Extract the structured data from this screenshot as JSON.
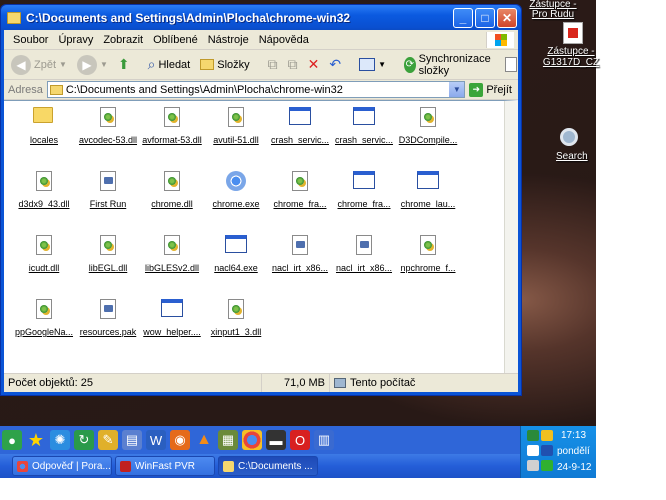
{
  "window": {
    "title": "C:\\Documents and Settings\\Admin\\Plocha\\chrome-win32"
  },
  "menu": [
    "Soubor",
    "Úpravy",
    "Zobrazit",
    "Oblíbené",
    "Nástroje",
    "Nápověda"
  ],
  "toolbar": {
    "back": "Zpět",
    "search": "Hledat",
    "folders": "Složky",
    "sync": "Synchronizace složky"
  },
  "address": {
    "label": "Adresa",
    "value": "C:\\Documents and Settings\\Admin\\Plocha\\chrome-win32",
    "go": "Přejít"
  },
  "files": [
    {
      "name": "locales",
      "icon": "folder-icon"
    },
    {
      "name": "avcodec-53.dll",
      "icon": "dll-icon"
    },
    {
      "name": "avformat-53.dll",
      "icon": "dll-icon"
    },
    {
      "name": "avutil-51.dll",
      "icon": "dll-icon"
    },
    {
      "name": "crash_servic...",
      "icon": "exe-icon"
    },
    {
      "name": "crash_servic...",
      "icon": "exe-icon"
    },
    {
      "name": "D3DCompile...",
      "icon": "dll-icon"
    },
    {
      "name": "d3dx9_43.dll",
      "icon": "dll-icon"
    },
    {
      "name": "First Run",
      "icon": "file-icon"
    },
    {
      "name": "chrome.dll",
      "icon": "dll-icon"
    },
    {
      "name": "chrome.exe",
      "icon": "chrome-icon"
    },
    {
      "name": "chrome_fra...",
      "icon": "dll-icon"
    },
    {
      "name": "chrome_fra...",
      "icon": "exe-icon"
    },
    {
      "name": "chrome_lau...",
      "icon": "exe-icon"
    },
    {
      "name": "icudt.dll",
      "icon": "dll-icon"
    },
    {
      "name": "libEGL.dll",
      "icon": "dll-icon"
    },
    {
      "name": "libGLESv2.dll",
      "icon": "dll-icon"
    },
    {
      "name": "nacl64.exe",
      "icon": "exe-icon"
    },
    {
      "name": "nacl_irt_x86...",
      "icon": "file-icon"
    },
    {
      "name": "nacl_irt_x86...",
      "icon": "file-icon"
    },
    {
      "name": "npchrome_f...",
      "icon": "dll-icon"
    },
    {
      "name": "ppGoogleNa...",
      "icon": "dll-icon"
    },
    {
      "name": "resources.pak",
      "icon": "file-icon"
    },
    {
      "name": "wow_helper....",
      "icon": "exe-icon"
    },
    {
      "name": "xinput1_3.dll",
      "icon": "dll-icon"
    }
  ],
  "status": {
    "count": "Počet objektů: 25",
    "size": "71,0 MB",
    "location": "Tento počítač"
  },
  "desktop": {
    "shortcut1": "Zástupce - Pro Rudu",
    "shortcut2": "Zástupce - G1317D_CZ",
    "search": "Search"
  },
  "taskbar": {
    "tasks": [
      "Odpověď | Pora...",
      "WinFast PVR",
      "C:\\Documents ..."
    ]
  },
  "tray": {
    "time": "17:13",
    "day": "pondělí",
    "date": "24-9-12"
  }
}
